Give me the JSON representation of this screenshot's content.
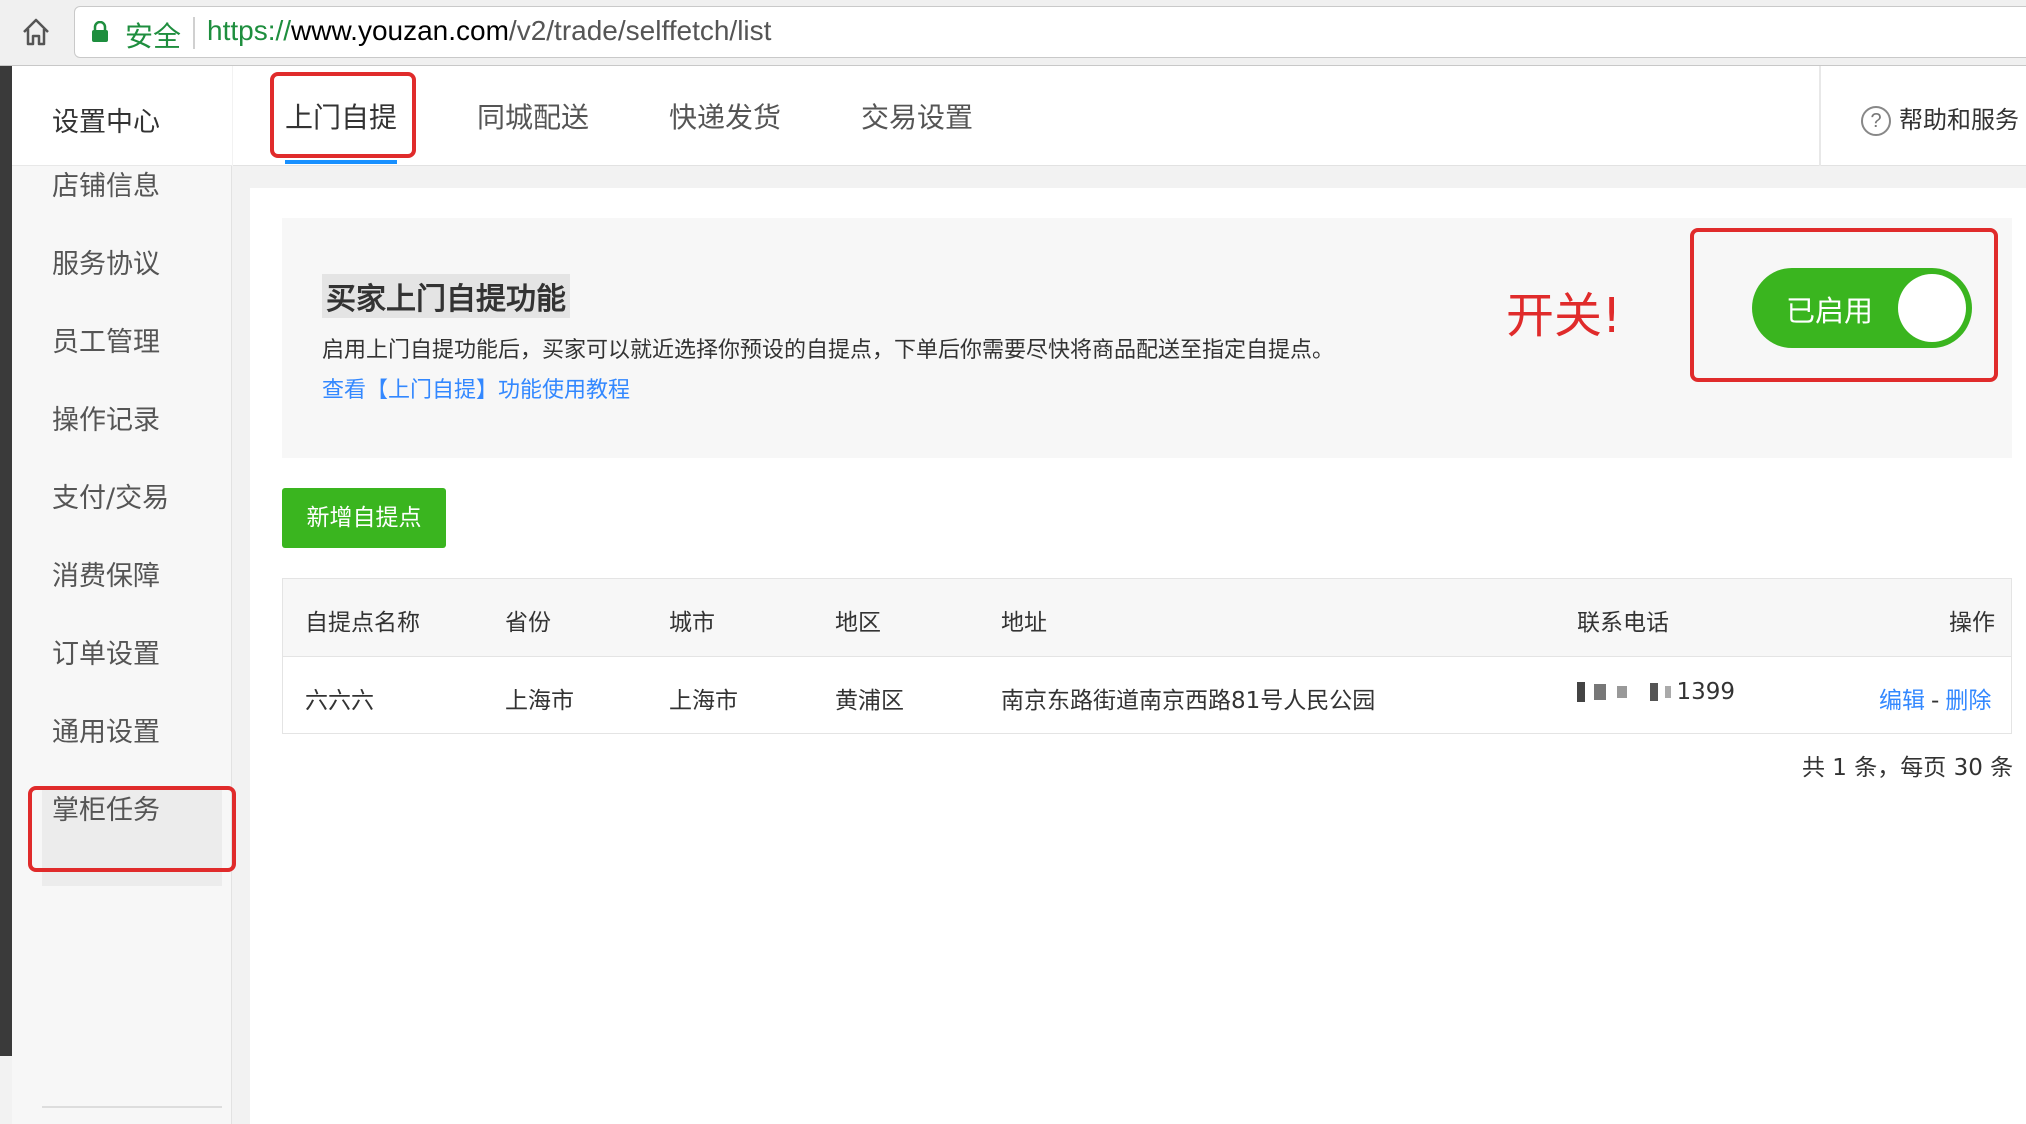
{
  "browser": {
    "secure_label": "安全",
    "url_scheme": "https://",
    "url_host": "www.youzan.com",
    "url_path": "/v2/trade/selffetch/list"
  },
  "sidebar": {
    "title": "设置中心",
    "items": [
      {
        "label": "店铺信息"
      },
      {
        "label": "服务协议"
      },
      {
        "label": "员工管理"
      },
      {
        "label": "操作记录"
      },
      {
        "label": "支付/交易"
      },
      {
        "label": "消费保障"
      },
      {
        "label": "订单设置"
      },
      {
        "label": "通用设置"
      },
      {
        "label": "掌柜任务"
      }
    ],
    "active": "订单设置"
  },
  "topnav": {
    "tabs": [
      {
        "label": "上门自提"
      },
      {
        "label": "同城配送"
      },
      {
        "label": "快递发货"
      },
      {
        "label": "交易设置"
      }
    ],
    "active": "上门自提",
    "help_label": "帮助和服务",
    "help_icon": "question-circle-icon"
  },
  "feature": {
    "title": "买家上门自提功能",
    "description": "启用上门自提功能后，买家可以就近选择你预设的自提点，下单后你需要尽快将商品配送至指定自提点。",
    "link": "查看【上门自提】功能使用教程",
    "toggle_label": "已启用",
    "toggle_on": true
  },
  "annotation": {
    "text": "开关!"
  },
  "actions": {
    "add_button": "新增自提点"
  },
  "table": {
    "columns": [
      "自提点名称",
      "省份",
      "城市",
      "地区",
      "地址",
      "联系电话",
      "操作"
    ],
    "rows": [
      {
        "name": "六六六",
        "province": "上海市",
        "city": "上海市",
        "district": "黄浦区",
        "address": "南京东路街道南京西路81号人民公园",
        "phone_visible": "1399",
        "edit": "编辑",
        "sep": "-",
        "delete": "删除"
      }
    ]
  },
  "pager": {
    "text": "共 1 条，每页 30 条"
  },
  "colors": {
    "accent_green": "#3ab51f",
    "link_blue": "#3388ff",
    "tab_underline": "#1890ff",
    "annotation_red": "#e02b2b"
  }
}
